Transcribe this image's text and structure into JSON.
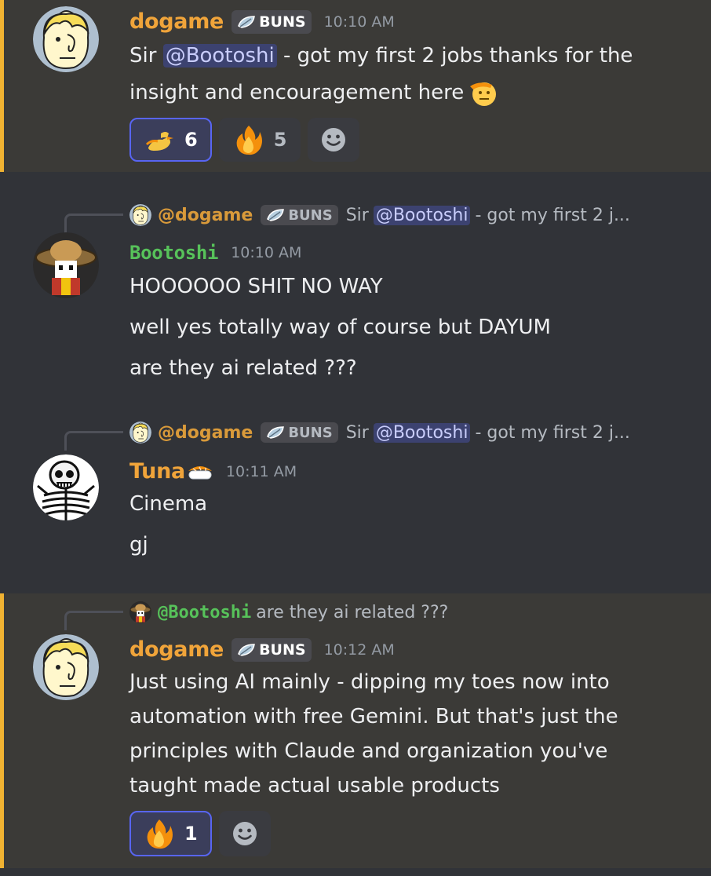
{
  "colors": {
    "background": "#313338",
    "highlight": "#3b3a37",
    "highlight_bar": "#f0b232",
    "dogame": "#f0a43a",
    "bootoshi": "#57c25a",
    "tuna": "#f0a43a",
    "mention_bg": "#3c4270",
    "mention_fg": "#c9cdfb"
  },
  "messages": [
    {
      "username": "dogame",
      "tag": "BUNS",
      "time": "10:10 AM",
      "lines": {
        "prefix": "Sir",
        "mention": "@Bootoshi",
        "rest": " - got my first 2 jobs thanks for the",
        "line2": "insight and encouragement here"
      },
      "reactions": [
        {
          "icon": "saluting-duck-emoji",
          "count": "6"
        },
        {
          "icon": "fire-emoji",
          "count": "5"
        }
      ]
    },
    {
      "reply": {
        "name": "@dogame",
        "tag": "BUNS",
        "prefix": "Sir",
        "mention": "@Bootoshi",
        "snippet": "- got my first 2 j..."
      },
      "username": "Bootoshi",
      "time": "10:10 AM",
      "lines": [
        "HOOOOOO SHIT NO WAY",
        "well yes totally way of course but DAYUM",
        "are they ai related ???"
      ]
    },
    {
      "reply": {
        "name": "@dogame",
        "tag": "BUNS",
        "prefix": "Sir",
        "mention": "@Bootoshi",
        "snippet": "- got my first 2 j..."
      },
      "username": "Tuna",
      "time": "10:11 AM",
      "lines": [
        "Cinema",
        "gj"
      ]
    },
    {
      "reply": {
        "name": "@Bootoshi",
        "snippet": "are they ai related ???"
      },
      "username": "dogame",
      "tag": "BUNS",
      "time": "10:12 AM",
      "lines": [
        "Just using AI mainly - dipping my toes now into",
        "automation with free Gemini. But that's just the",
        "principles with Claude and organization you've",
        "taught made actual usable products"
      ],
      "reactions": [
        {
          "icon": "fire-emoji",
          "count": "1"
        }
      ]
    }
  ]
}
